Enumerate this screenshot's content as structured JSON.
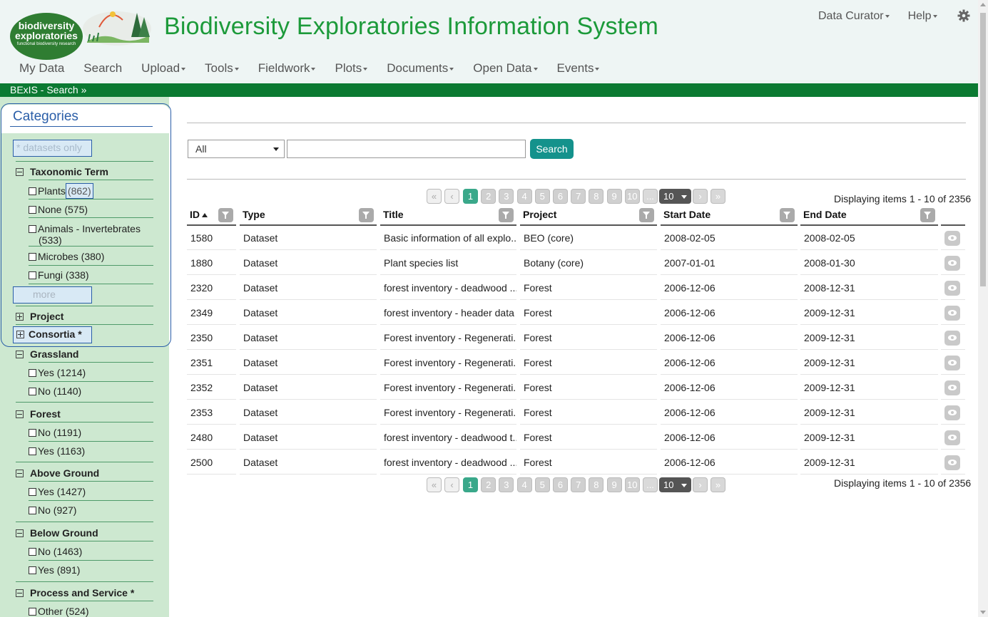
{
  "header": {
    "logo_line1": "biodiversity",
    "logo_line2": "exploratories",
    "logo_line3": "functional biodiversity research",
    "title": "Biodiversity Exploratories Information System",
    "title_color": "#1c9a3a",
    "user_menu": "Data Curator",
    "help_menu": "Help",
    "settings_icon": "gear-icon"
  },
  "nav": [
    "My Data",
    "Search",
    "Upload",
    "Tools",
    "Fieldwork",
    "Plots",
    "Documents",
    "Open Data",
    "Events"
  ],
  "nav_has_caret": [
    false,
    false,
    true,
    true,
    true,
    true,
    true,
    true,
    true
  ],
  "breadcrumb_bar": {
    "label": "BExIS - Search »",
    "color": "#0b7a32"
  },
  "sidebar": {
    "title": "Categories",
    "datasets_only": "* datasets only",
    "more": "more",
    "taxonomic": {
      "label": "Taxonomic Term",
      "options": [
        {
          "label": "Plants",
          "count": "(862)"
        },
        {
          "label": "None (575)"
        },
        {
          "label": "Animals - Invertebrates",
          "label2": "(533)"
        },
        {
          "label": "Microbes (380)"
        },
        {
          "label": "Fungi (338)"
        }
      ]
    },
    "project": "Project",
    "consortia": "Consortia *",
    "grassland": {
      "label": "Grassland",
      "options": [
        "Yes (1214)",
        "No (1140)"
      ]
    },
    "forest": {
      "label": "Forest",
      "options": [
        "No (1191)",
        "Yes (1163)"
      ]
    },
    "above": {
      "label": "Above Ground",
      "options": [
        "Yes (1427)",
        "No (927)"
      ]
    },
    "below": {
      "label": "Below Ground",
      "options": [
        "No (1463)",
        "Yes (891)"
      ]
    },
    "process": {
      "label": "Process and Service *",
      "options": [
        "Other (524)"
      ]
    }
  },
  "search": {
    "scope": "All",
    "query": "",
    "button": "Search",
    "button_color": "#14928c"
  },
  "pager": {
    "first": "«",
    "prev": "‹",
    "next": "›",
    "last": "»",
    "pages": [
      "1",
      "2",
      "3",
      "4",
      "5",
      "6",
      "7",
      "8",
      "9",
      "10"
    ],
    "ellipsis": "...",
    "page_size": "10",
    "display": "Displaying items 1 - 10 of 2356",
    "active_color": "#3aa88a"
  },
  "table": {
    "headers": [
      "ID",
      "Type",
      "Title",
      "Project",
      "Start Date",
      "End Date"
    ],
    "rows": [
      [
        "1580",
        "Dataset",
        "Basic information of all explo...",
        "BEO (core)",
        "2008-02-05",
        "2008-02-05"
      ],
      [
        "1880",
        "Dataset",
        "Plant species list",
        "Botany (core)",
        "2007-01-01",
        "2008-01-30"
      ],
      [
        "2320",
        "Dataset",
        "forest inventory - deadwood ...",
        "Forest",
        "2006-12-06",
        "2008-12-31"
      ],
      [
        "2349",
        "Dataset",
        "forest inventory - header data",
        "Forest",
        "2006-12-06",
        "2009-12-31"
      ],
      [
        "2350",
        "Dataset",
        "Forest inventory - Regenerati...",
        "Forest",
        "2006-12-06",
        "2009-12-31"
      ],
      [
        "2351",
        "Dataset",
        "Forest inventory - Regenerati...",
        "Forest",
        "2006-12-06",
        "2009-12-31"
      ],
      [
        "2352",
        "Dataset",
        "Forest inventory - Regenerati...",
        "Forest",
        "2006-12-06",
        "2009-12-31"
      ],
      [
        "2353",
        "Dataset",
        "Forest inventory - Regenerati...",
        "Forest",
        "2006-12-06",
        "2009-12-31"
      ],
      [
        "2480",
        "Dataset",
        "forest inventory - deadwood t...",
        "Forest",
        "2006-12-06",
        "2009-12-31"
      ],
      [
        "2500",
        "Dataset",
        "forest inventory - deadwood ...",
        "Forest",
        "2006-12-06",
        "2009-12-31"
      ]
    ]
  }
}
